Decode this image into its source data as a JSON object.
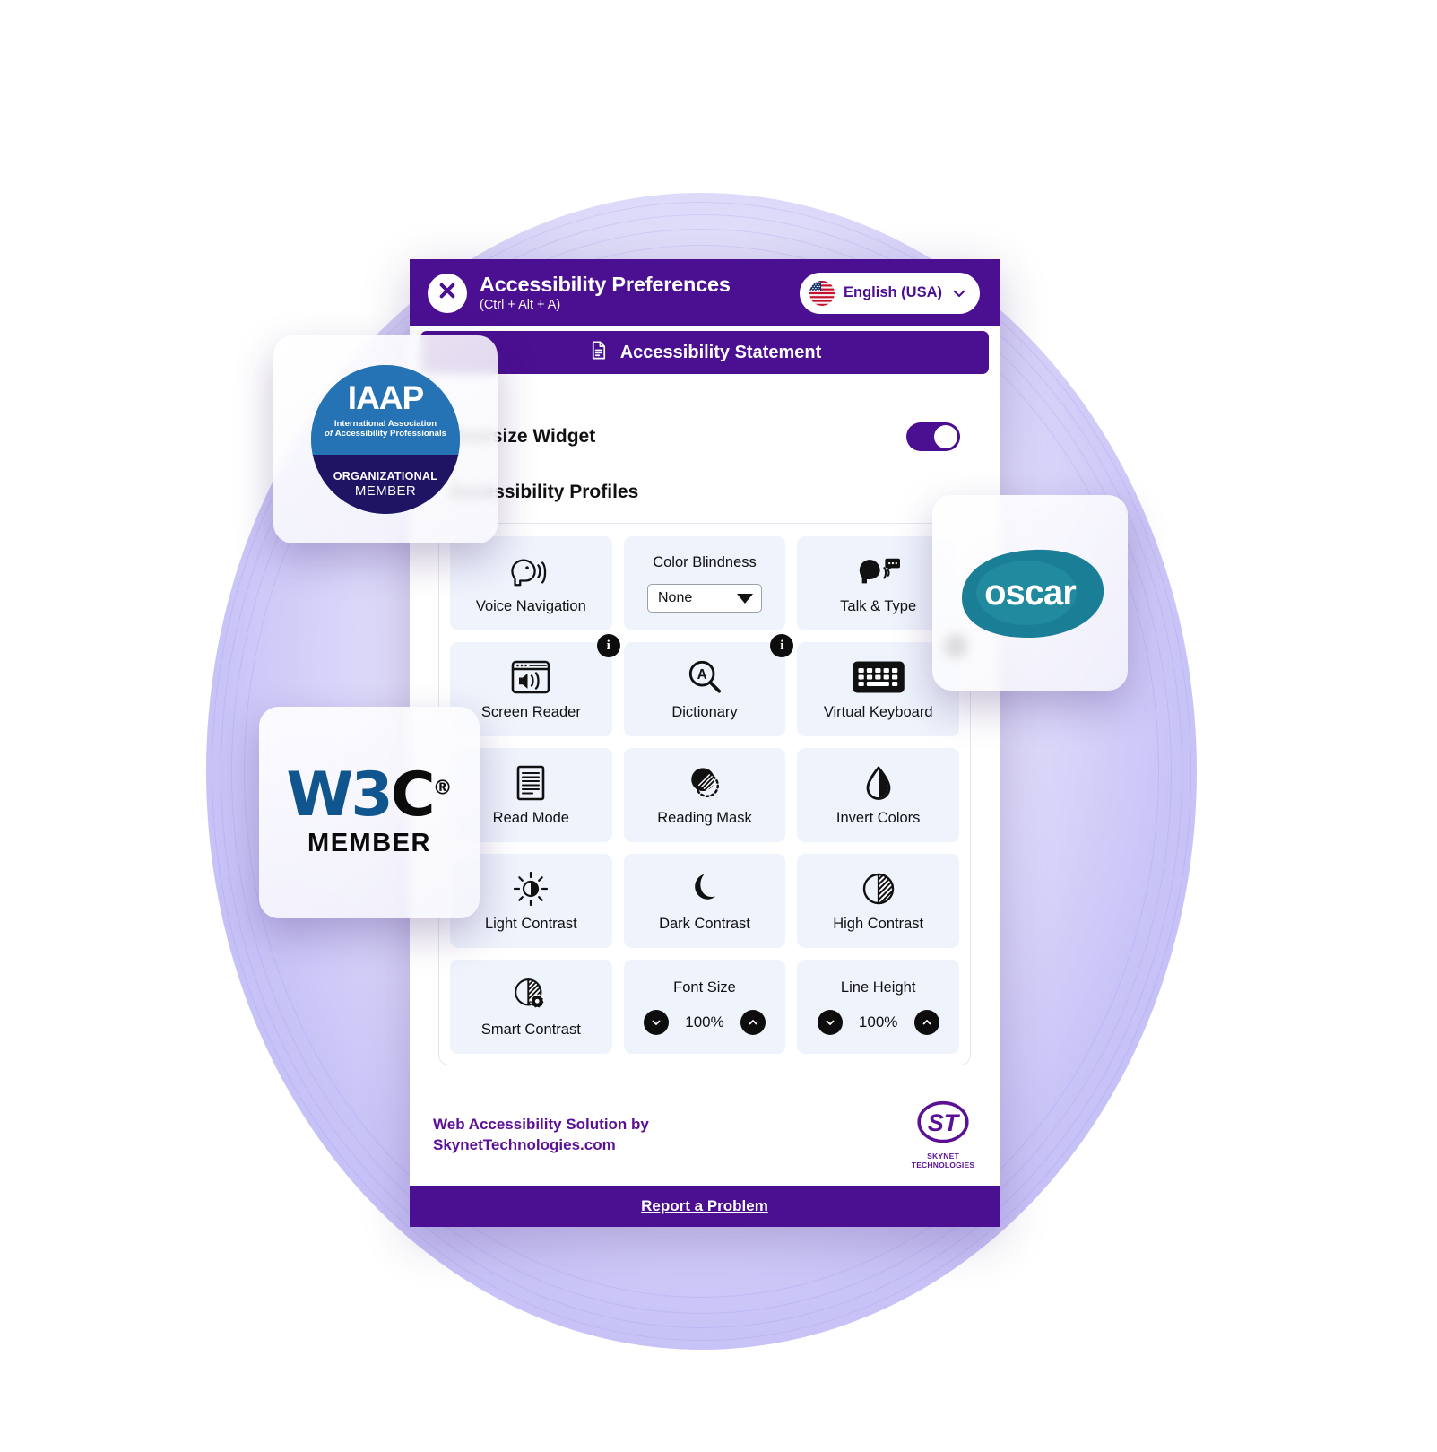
{
  "header": {
    "close_icon": "close-icon",
    "title": "Accessibility Preferences",
    "shortcut": "(Ctrl + Alt + A)",
    "language": "English (USA)",
    "flag_icon": "us-flag-icon",
    "chevron_icon": "chevron-down-icon"
  },
  "statement": {
    "label": "Accessibility Statement",
    "icon": "document-icon"
  },
  "settings": {
    "oversize_widget_label": "Oversize Widget",
    "oversize_widget_state": "on",
    "profiles_heading": "Accessibility Profiles"
  },
  "grid": [
    {
      "name": "voice-navigation",
      "label": "Voice Navigation",
      "icon": "speaking-head-icon",
      "type": "toggle",
      "info": false
    },
    {
      "name": "color-blindness",
      "label": "Color Blindness",
      "icon": "none",
      "type": "select",
      "value": "None",
      "options": [
        "None"
      ],
      "info": false
    },
    {
      "name": "talk-and-type",
      "label": "Talk & Type",
      "icon": "head-speech-bubble-icon",
      "type": "toggle",
      "info": false
    },
    {
      "name": "screen-reader",
      "label": "Screen Reader",
      "icon": "browser-speaker-icon",
      "type": "toggle",
      "info": true
    },
    {
      "name": "dictionary",
      "label": "Dictionary",
      "icon": "magnifier-a-icon",
      "type": "toggle",
      "info": true
    },
    {
      "name": "virtual-keyboard",
      "label": "Virtual Keyboard",
      "icon": "keyboard-icon",
      "type": "toggle",
      "info": true
    },
    {
      "name": "read-mode",
      "label": "Read Mode",
      "icon": "document-lines-icon",
      "type": "toggle",
      "info": false
    },
    {
      "name": "reading-mask",
      "label": "Reading Mask",
      "icon": "mask-circle-icon",
      "type": "toggle",
      "info": false
    },
    {
      "name": "invert-colors",
      "label": "Invert Colors",
      "icon": "droplet-half-icon",
      "type": "toggle",
      "info": false
    },
    {
      "name": "light-contrast",
      "label": "Light Contrast",
      "icon": "sun-half-icon",
      "type": "toggle",
      "info": false
    },
    {
      "name": "dark-contrast",
      "label": "Dark Contrast",
      "icon": "moon-icon",
      "type": "toggle",
      "info": false
    },
    {
      "name": "high-contrast",
      "label": "High Contrast",
      "icon": "circle-half-hatched-icon",
      "type": "toggle",
      "info": false
    },
    {
      "name": "smart-contrast",
      "label": "Smart Contrast",
      "icon": "circle-half-gear-icon",
      "type": "toggle",
      "info": false
    },
    {
      "name": "font-size",
      "label": "Font Size",
      "icon": "none",
      "type": "stepper",
      "value": "100%",
      "info": false
    },
    {
      "name": "line-height",
      "label": "Line Height",
      "icon": "none",
      "type": "stepper",
      "value": "100%",
      "info": false
    }
  ],
  "info_badge_char": "i",
  "footer": {
    "text_line1": "Web Accessibility Solution by",
    "text_line2": "SkynetTechnologies.com",
    "logo_mark": "ST",
    "logo_name": "SKYNET TECHNOLOGIES",
    "report_label": "Report a Problem"
  },
  "badges": {
    "iaap": {
      "word": "IAAP",
      "line1": "International Association",
      "line2_italic": "of",
      "line2": "Accessibility Professionals",
      "org": "ORGANIZATIONAL",
      "member": "MEMBER"
    },
    "w3c": {
      "w3": "W3",
      "c": "C",
      "reg": "®",
      "member": "MEMBER"
    },
    "oscar": {
      "word": "oscar"
    }
  },
  "colors": {
    "brand_purple": "#4b0f91",
    "cell_bg": "#eef3fc",
    "iaap_blue": "#2573b4",
    "iaap_navy": "#1f1464",
    "w3c_blue": "#11558f",
    "oscar_teal": "#1a7f96"
  }
}
